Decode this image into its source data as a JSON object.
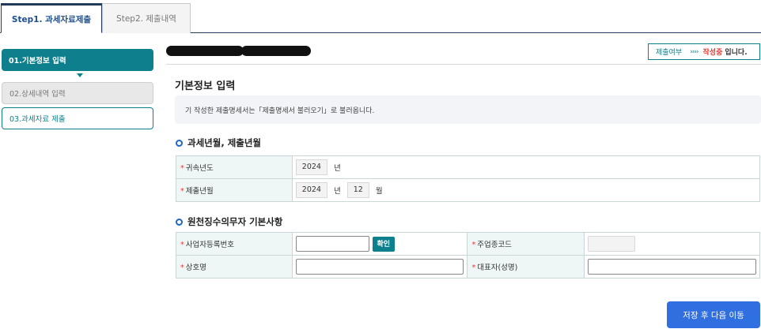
{
  "tabs": [
    {
      "label": "Step1. 과세자료제출",
      "active": true
    },
    {
      "label": "Step2. 제출내역",
      "active": false
    }
  ],
  "steps": [
    {
      "label": "01.기본정보 입력",
      "state": "active"
    },
    {
      "label": "02.상세내역 입력",
      "state": "disabled"
    },
    {
      "label": "03.과세자료 제출",
      "state": "pending"
    }
  ],
  "status": {
    "label": "제출여부",
    "arrows": "››››",
    "state": "작성중",
    "suffix": "입니다."
  },
  "page_title": "기본정보 입력",
  "notice": "기 작성한 제출명세서는「제출명세서 불러오기」로 불러옵니다.",
  "section1": {
    "title": "과세년월, 제출년월",
    "rows": [
      {
        "label": "귀속년도",
        "year": "2024",
        "year_unit": "년"
      },
      {
        "label": "제출년월",
        "year": "2024",
        "year_unit": "년",
        "month": "12",
        "month_unit": "월"
      }
    ]
  },
  "section2": {
    "title": "원천징수의무자 기본사항",
    "business_no_label": "사업자등록번호",
    "business_no_value": "",
    "confirm_label": "확인",
    "industry_code_label": "주업종코드",
    "industry_code_value": "",
    "company_name_label": "상호명",
    "company_name_value": "",
    "representative_label": "대표자(성명)",
    "representative_value": ""
  },
  "required_mark": "*",
  "save_button": "저장 후 다음 이동",
  "colors": {
    "accent": "#0e7f8c",
    "primary_button": "#2f6fe0",
    "required": "#e53935",
    "tab_active_text": "#1f4e8c"
  }
}
